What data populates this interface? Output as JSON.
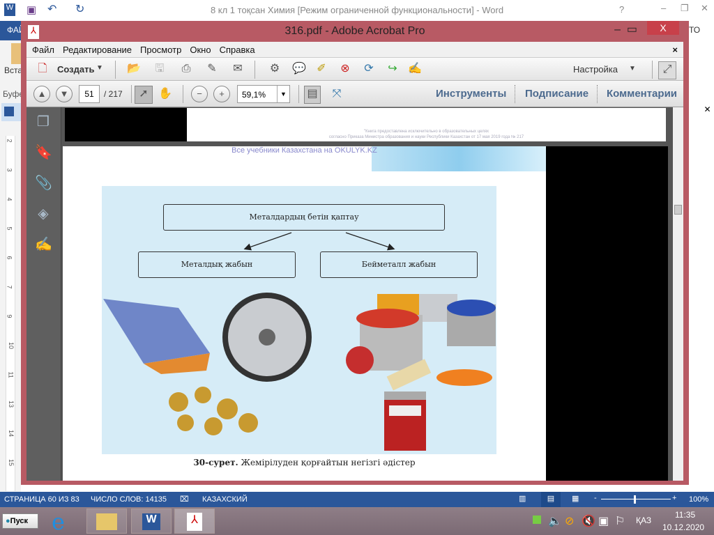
{
  "word": {
    "title": "8 кл 1 тоқсан Химия [Режим ограниченной функциональности] - Word",
    "file_tab": "ФАЙ",
    "paste": "Вста",
    "clipboard": "Буфе",
    "right_tab": "ТО",
    "help": "?",
    "ruler_marks": [
      "2",
      "3",
      "4",
      "5",
      "6",
      "7",
      "9",
      "10",
      "11",
      "13",
      "14",
      "15"
    ]
  },
  "acrobat": {
    "title": "316.pdf - Adobe Acrobat Pro",
    "close": "X",
    "menu": [
      "Файл",
      "Редактирование",
      "Просмотр",
      "Окно",
      "Справка"
    ],
    "create_label": "Создать",
    "customize_label": "Настройка",
    "page_current": "51",
    "page_total": "/ 217",
    "zoom": "59,1%",
    "panels": [
      "Инструменты",
      "Подписание",
      "Комментарии"
    ]
  },
  "document": {
    "notice_line1": "\"Книга предоставлена исключительно в образовательных целях",
    "notice_line2": "согласно Приказа Министра образования и науки Республики Казахстан от 17 мая 2019 года № 217",
    "site": "Все учебники Казахстана на OKULYK.KZ",
    "diagram": {
      "root": "Металдардың бетін қаптау",
      "left": "Металдық жабын",
      "right": "Бейметалл жабын"
    },
    "caption_bold": "30-сурет.",
    "caption": "Жемірілуден қорғайтын негізгі әдістер"
  },
  "status": {
    "page": "СТРАНИЦА 60 ИЗ 83",
    "words": "ЧИСЛО СЛОВ: 14135",
    "lang": "КАЗАХСКИЙ",
    "zoom": "100%"
  },
  "taskbar": {
    "start": "Пуск",
    "lang": "ҚАЗ",
    "time": "11:35",
    "date": "10.12.2020"
  }
}
